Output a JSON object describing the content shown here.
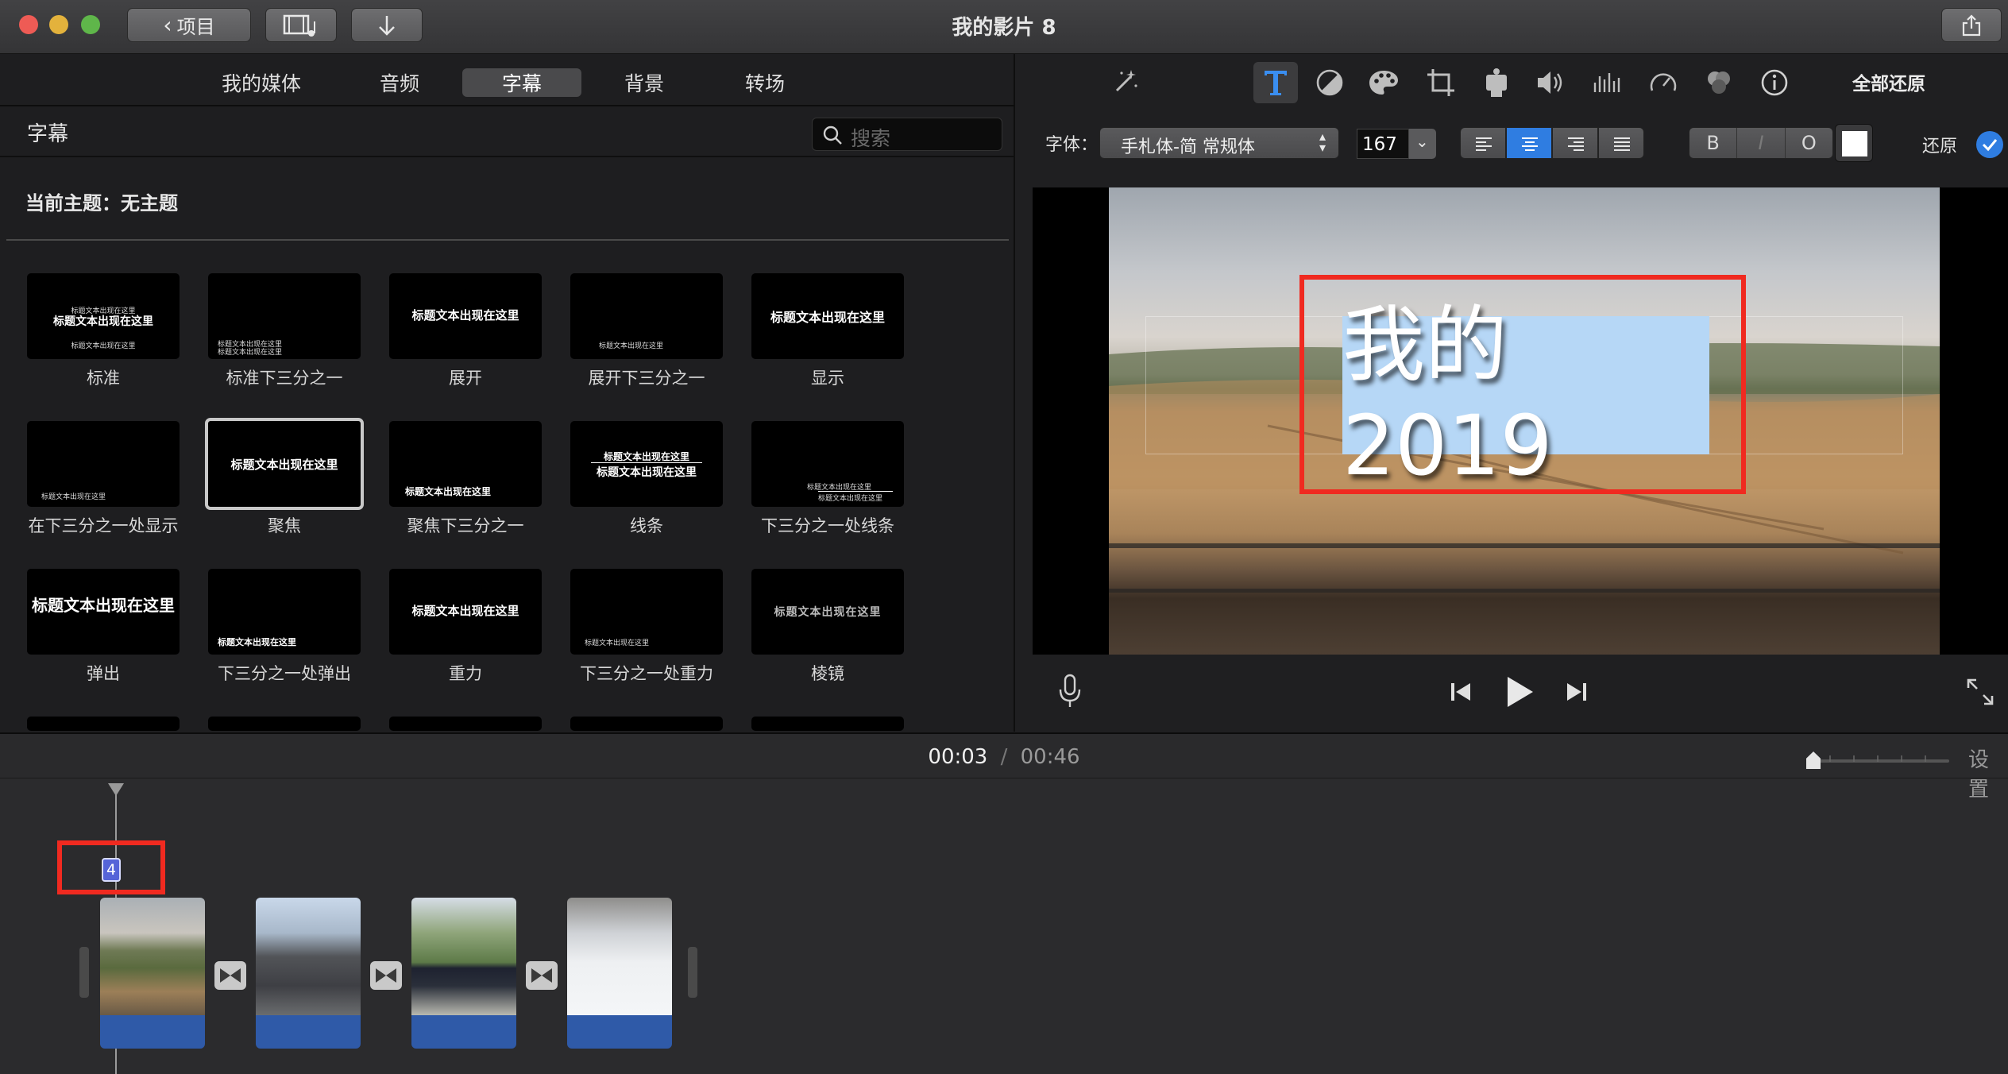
{
  "window": {
    "title": "我的影片 8",
    "back_button": "项目"
  },
  "browser": {
    "tabs": [
      "我的媒体",
      "音频",
      "字幕",
      "背景",
      "转场"
    ],
    "active_tab": "字幕",
    "section_title": "字幕",
    "search_placeholder": "搜索",
    "theme_label": "当前主题：无主题",
    "titles": [
      {
        "label": "标准",
        "preview": "标题文本出现在这里"
      },
      {
        "label": "标准下三分之一",
        "preview": "标题文本出现在这里"
      },
      {
        "label": "展开",
        "preview": "标题文本出现在这里"
      },
      {
        "label": "展开下三分之一",
        "preview": "标题文本出现在这里"
      },
      {
        "label": "显示",
        "preview": "标题文本出现在这里"
      },
      {
        "label": "在下三分之一处显示",
        "preview": "标题文本出现在这里"
      },
      {
        "label": "聚焦",
        "preview": "标题文本出现在这里"
      },
      {
        "label": "聚焦下三分之一",
        "preview": "标题文本出现在这里"
      },
      {
        "label": "线条",
        "preview": "标题文本出现在这里"
      },
      {
        "label": "下三分之一处线条",
        "preview": "标题文本出现在这里"
      },
      {
        "label": "弹出",
        "preview": "标题文本出现在这里"
      },
      {
        "label": "下三分之一处弹出",
        "preview": "标题文本出现在这里"
      },
      {
        "label": "重力",
        "preview": "标题文本出现在这里"
      },
      {
        "label": "下三分之一处重力",
        "preview": "标题文本出现在这里"
      },
      {
        "label": "棱镜",
        "preview": "标题文本出现在这里"
      }
    ],
    "selected_title": "聚焦"
  },
  "viewer": {
    "reset_all": "全部还原",
    "font_label": "字体：",
    "font_name": "手札体-简 常规体",
    "font_size": "167",
    "bold_label": "B",
    "italic_label": "I",
    "outline_label": "O",
    "revert_label": "还原",
    "title_text": "我的2019",
    "text_color": "#ffffff",
    "accent": "#2f7de1"
  },
  "timeline": {
    "current_time": "00:03",
    "separator": "/",
    "total_time": "00:46",
    "settings_label": "设置",
    "title_marker": "4",
    "clips": [
      "countryside",
      "cathedral",
      "garden-path",
      "snow-hill"
    ]
  }
}
